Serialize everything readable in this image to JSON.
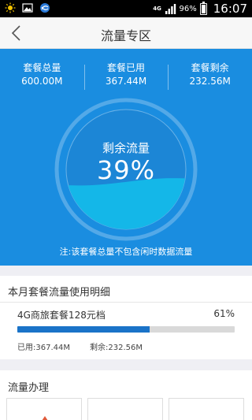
{
  "status_bar": {
    "network": "4G",
    "battery": "96%",
    "time": "16:07",
    "icons": [
      "weather-sun-icon",
      "image-notification-icon",
      "china-mobile-icon",
      "signal-icon",
      "battery-icon"
    ]
  },
  "header": {
    "title": "流量专区",
    "back_icon": "chevron-left-icon"
  },
  "summary": {
    "total_label": "套餐总量",
    "total_value": "600.00M",
    "used_label": "套餐已用",
    "used_value": "367.44M",
    "remaining_label": "套餐剩余",
    "remaining_value": "232.56M"
  },
  "gauge": {
    "label": "剩余流量",
    "percent_text": "39%",
    "fill_fraction": 0.39
  },
  "note": "注:该套餐总量不包含闲时数据流量",
  "detail": {
    "title": "本月套餐流量使用明细",
    "plan_name": "4G商旅套餐128元档",
    "plan_percent": "61%",
    "used_fraction": 0.61,
    "used_text": "已用:367.44M",
    "remaining_text": "剩余:232.56M"
  },
  "handling": {
    "title": "流量办理"
  },
  "colors": {
    "panel_blue": "#1a8de0",
    "wave_cyan": "#14b7e8",
    "bar_blue": "#1a73c8"
  }
}
